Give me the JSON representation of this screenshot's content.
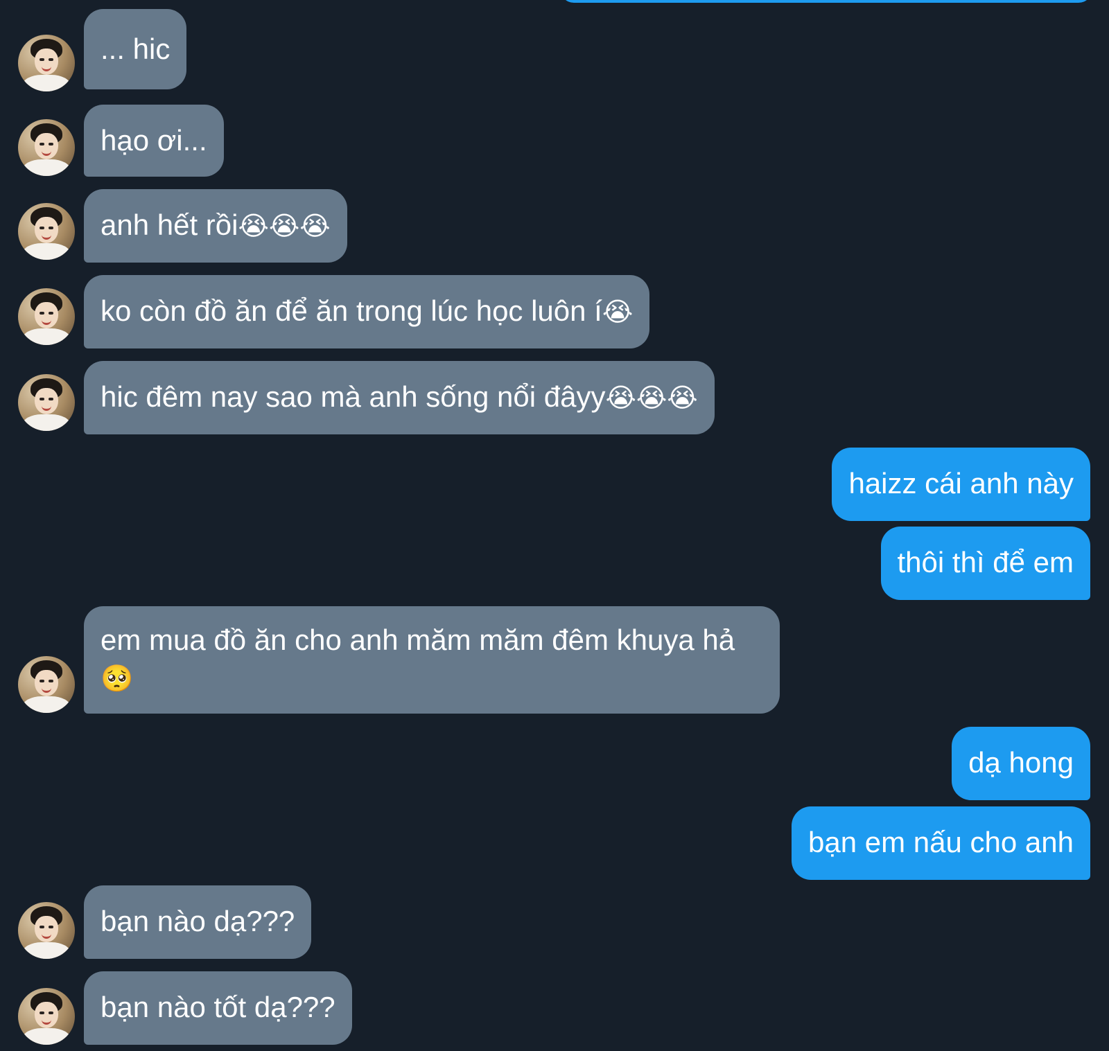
{
  "messages": [
    {
      "side": "in",
      "text": "... hic",
      "emoji": ""
    },
    {
      "side": "in",
      "text": "hạo ơi...",
      "emoji": ""
    },
    {
      "side": "in",
      "text": "anh hết rồi",
      "emoji": "😭😭😭"
    },
    {
      "side": "in",
      "text": "ko còn đồ ăn để ăn trong lúc học luôn í",
      "emoji": "😭"
    },
    {
      "side": "in",
      "text": "hic đêm nay sao mà anh sống nổi đâyy",
      "emoji": "😭😭😭"
    },
    {
      "side": "out",
      "text": "haizz cái anh này",
      "emoji": ""
    },
    {
      "side": "out",
      "text": "thôi thì để em",
      "emoji": ""
    },
    {
      "side": "in",
      "text": "em mua đồ ăn cho anh măm măm đêm khuya hả",
      "emoji": "🥺"
    },
    {
      "side": "out",
      "text": "dạ hong",
      "emoji": ""
    },
    {
      "side": "out",
      "text": "bạn em nấu cho anh",
      "emoji": ""
    },
    {
      "side": "in",
      "text": "bạn nào dạ???",
      "emoji": ""
    },
    {
      "side": "in",
      "text": "bạn nào tốt dạ???",
      "emoji": ""
    }
  ],
  "colors": {
    "background": "#161f2a",
    "incoming_bubble": "#66798b",
    "outgoing_bubble": "#1d9bf0",
    "text": "#ffffff"
  }
}
